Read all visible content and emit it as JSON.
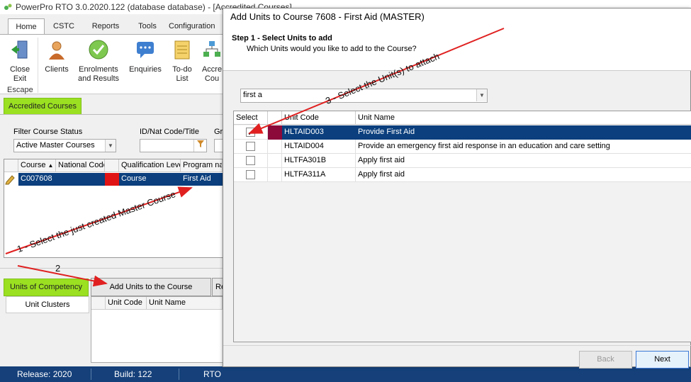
{
  "window": {
    "title": "PowerPro RTO 3.0.2020.122 (database database) - [Accredited Courses]"
  },
  "menu_tabs": [
    "Home",
    "CSTC",
    "Reports",
    "Tools",
    "Configuration"
  ],
  "ribbon": {
    "buttons": [
      {
        "label": "Close Exit",
        "icon": "exit-door-icon"
      },
      {
        "label": "Clients",
        "icon": "person-icon"
      },
      {
        "label": "Enrolments and Results",
        "icon": "check-circle-icon"
      },
      {
        "label": "Enquiries",
        "icon": "speech-bubble-icon"
      },
      {
        "label": "To-do List",
        "icon": "notepad-icon"
      },
      {
        "label": "Accre Cou",
        "icon": "network-icon"
      }
    ],
    "group_label": "Escape"
  },
  "accredited_tab": "Accredited Courses",
  "filter": {
    "status_label": "Filter Course Status",
    "status_value": "Active Master Courses",
    "id_label": "ID/Nat Code/Title",
    "gr_label": "Gr"
  },
  "course_grid": {
    "headers": [
      "Course",
      "National Code",
      "",
      "Qualification Level",
      "Program name"
    ],
    "row": {
      "course": "C007608",
      "national_code": "",
      "qualification": "Course",
      "program": "First Aid"
    }
  },
  "bottom": {
    "units_tab": "Units of Competency",
    "clusters_tab": "Unit Clusters",
    "add_button": "Add Units to the Course",
    "re_button": "Re",
    "grid_headers": [
      "Unit Code",
      "Unit Name"
    ]
  },
  "statusbar": {
    "release": "Release: 2020",
    "build": "Build: 122",
    "rto": "RTO"
  },
  "dialog": {
    "title": "Add Units to Course 7608 - First Aid (MASTER)",
    "step_title": "Step 1 - Select Units to add",
    "step_subtitle": "Which Units would you like to add to the Course?",
    "search_value": "first a",
    "headers": [
      "Select",
      "",
      "Unit Code",
      "Unit Name"
    ],
    "rows": [
      {
        "checked": true,
        "code": "HLTAID003",
        "name": "Provide First Aid",
        "selected": true
      },
      {
        "checked": false,
        "code": "HLTAID004",
        "name": "Provide an emergency first aid response in an education and care setting",
        "selected": false
      },
      {
        "checked": false,
        "code": "HLTFA301B",
        "name": "Apply first aid",
        "selected": false
      },
      {
        "checked": false,
        "code": "HLTFA311A",
        "name": "Apply first aid",
        "selected": false
      }
    ],
    "back": "Back",
    "next": "Next"
  },
  "annotations": {
    "note1": "1 - Select the just created Master Course",
    "note2": "2",
    "note3": "3 - Select the Unit(s) to attach",
    "arrow_color": "#e02020"
  },
  "colors": {
    "accent_green": "#9be021",
    "selection_blue": "#0b3f7d",
    "status_blue": "#15407a",
    "maroon": "#8b0a3a"
  }
}
